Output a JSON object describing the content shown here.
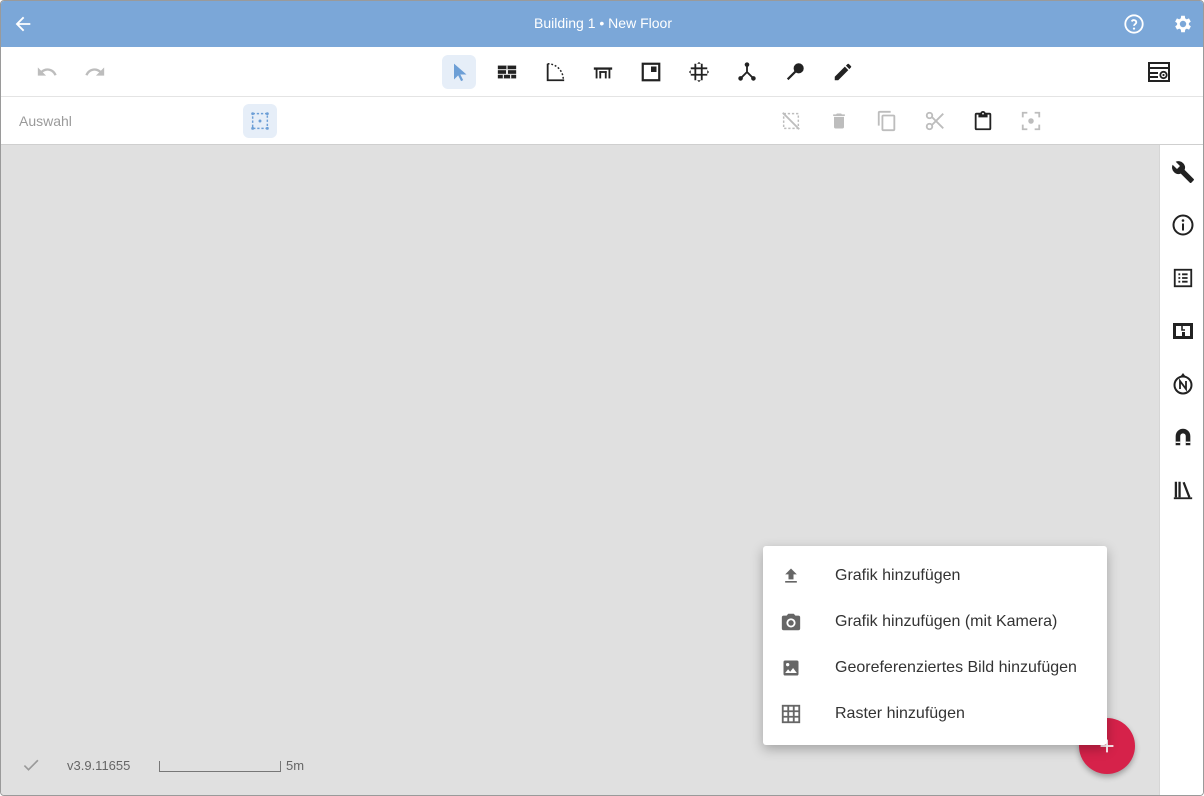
{
  "header": {
    "title": "Building 1 • New Floor",
    "icons": [
      "arrow-back-icon",
      "help-icon",
      "settings-icon"
    ]
  },
  "toolbar": {
    "history_icons": [
      "undo-icon",
      "redo-icon"
    ],
    "tools": [
      "select-pointer-icon",
      "wall-icon",
      "door-arc-icon",
      "furniture-icon",
      "room-icon",
      "grid-move-icon",
      "node-icon",
      "pin-icon",
      "pencil-icon"
    ],
    "right_icon": "layer-view-icon"
  },
  "subbar": {
    "label": "Auswahl",
    "selection_mode_icon": "selection-box-icon",
    "actions": [
      "deselect-icon",
      "delete-icon",
      "copy-icon",
      "cut-icon",
      "paste-icon",
      "focus-icon"
    ]
  },
  "sidebar": {
    "icons": [
      "wrench-icon",
      "info-icon",
      "list-icon",
      "floor-plan-icon",
      "compass-north-icon",
      "magnet-icon",
      "library-icon"
    ]
  },
  "status": {
    "version": "v3.9.11655",
    "scale_label": "5m"
  },
  "menu": {
    "items": [
      {
        "label": "Grafik hinzufügen",
        "icon": "upload-icon"
      },
      {
        "label": "Grafik hinzufügen (mit Kamera)",
        "icon": "camera-icon"
      },
      {
        "label": "Georeferenziertes Bild hinzufügen",
        "icon": "image-icon"
      },
      {
        "label": "Raster hinzufügen",
        "icon": "grid-icon"
      }
    ]
  },
  "colors": {
    "header": "#7ba7d8",
    "canvas": "#e0e0e0",
    "fab": "#d6224a",
    "active_tool_bg": "#e6eef8"
  }
}
